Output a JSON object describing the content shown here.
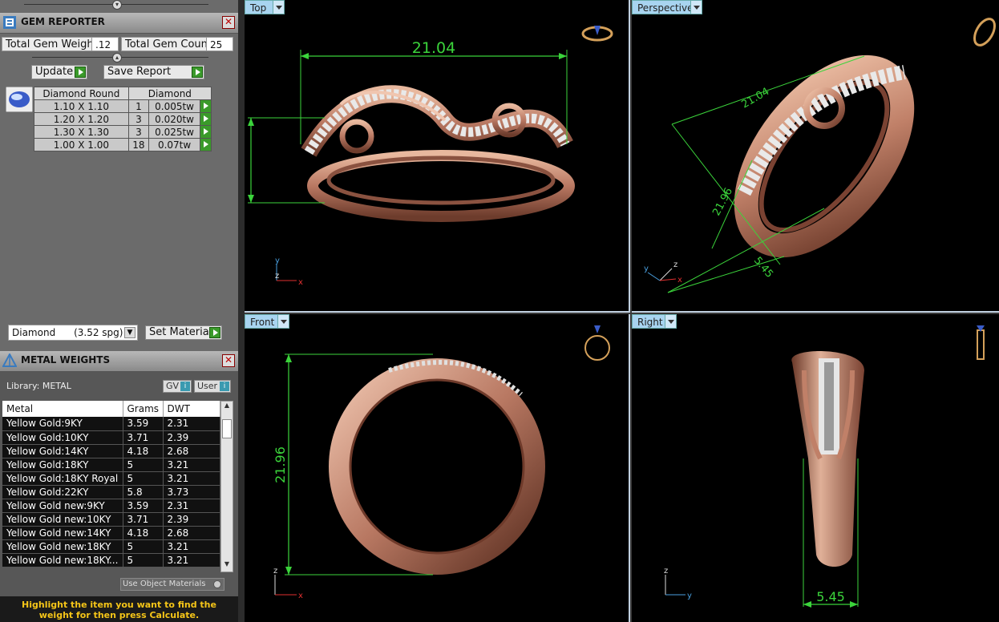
{
  "gem_reporter": {
    "title": "GEM REPORTER",
    "total_gem_weight_label": "Total Gem Weight",
    "total_gem_weight_value": ".12",
    "total_gem_count_label": "Total Gem Count",
    "total_gem_count_value": "25",
    "update_label": "Update",
    "save_report_label": "Save Report",
    "table_headers": [
      "Diamond Round",
      "Diamond"
    ],
    "rows": [
      {
        "size": "1.10 X 1.10",
        "count": "1",
        "weight": "0.005tw"
      },
      {
        "size": "1.20 X 1.20",
        "count": "3",
        "weight": "0.020tw"
      },
      {
        "size": "1.30 X 1.30",
        "count": "3",
        "weight": "0.025tw"
      },
      {
        "size": "1.00 X 1.00",
        "count": "18",
        "weight": "0.07tw"
      }
    ],
    "material_select": "Diamond      (3.52 spg)",
    "set_material_label": "Set Material"
  },
  "metal_weights": {
    "title": "METAL WEIGHTS",
    "library_label": "Library: METAL",
    "gv_label": "GV",
    "user_label": "User",
    "headers": [
      "Metal",
      "Grams",
      "DWT"
    ],
    "rows": [
      {
        "metal": "Yellow Gold:9KY",
        "grams": "3.59",
        "dwt": "2.31"
      },
      {
        "metal": "Yellow Gold:10KY",
        "grams": "3.71",
        "dwt": "2.39"
      },
      {
        "metal": "Yellow Gold:14KY",
        "grams": "4.18",
        "dwt": "2.68"
      },
      {
        "metal": "Yellow Gold:18KY",
        "grams": "5",
        "dwt": "3.21"
      },
      {
        "metal": "Yellow Gold:18KY Royal",
        "grams": "5",
        "dwt": "3.21"
      },
      {
        "metal": "Yellow Gold:22KY",
        "grams": "5.8",
        "dwt": "3.73"
      },
      {
        "metal": "Yellow Gold new:9KY",
        "grams": "3.59",
        "dwt": "2.31"
      },
      {
        "metal": "Yellow Gold new:10KY",
        "grams": "3.71",
        "dwt": "2.39"
      },
      {
        "metal": "Yellow Gold new:14KY",
        "grams": "4.18",
        "dwt": "2.68"
      },
      {
        "metal": "Yellow Gold new:18KY",
        "grams": "5",
        "dwt": "3.21"
      },
      {
        "metal": "Yellow Gold new:18KY...",
        "grams": "5",
        "dwt": "3.21"
      }
    ],
    "use_object_materials_label": "Use Object Materials",
    "hint": "Highlight the item you want to find the weight for then press Calculate."
  },
  "viewports": {
    "top": {
      "label": "Top",
      "dim_width": "21.04"
    },
    "perspective": {
      "label": "Perspective",
      "dim_a": "21.04",
      "dim_b": "21.96",
      "dim_c": "5.45"
    },
    "front": {
      "label": "Front",
      "dim_height": "21.96"
    },
    "right": {
      "label": "Right",
      "dim_width": "5.45"
    }
  },
  "axes": {
    "x": "x",
    "y": "y",
    "z": "z"
  },
  "colors": {
    "dimension": "#3bd43b",
    "rose_gold": "#c78a6e",
    "viewport_tab": "#a8d4f0"
  }
}
